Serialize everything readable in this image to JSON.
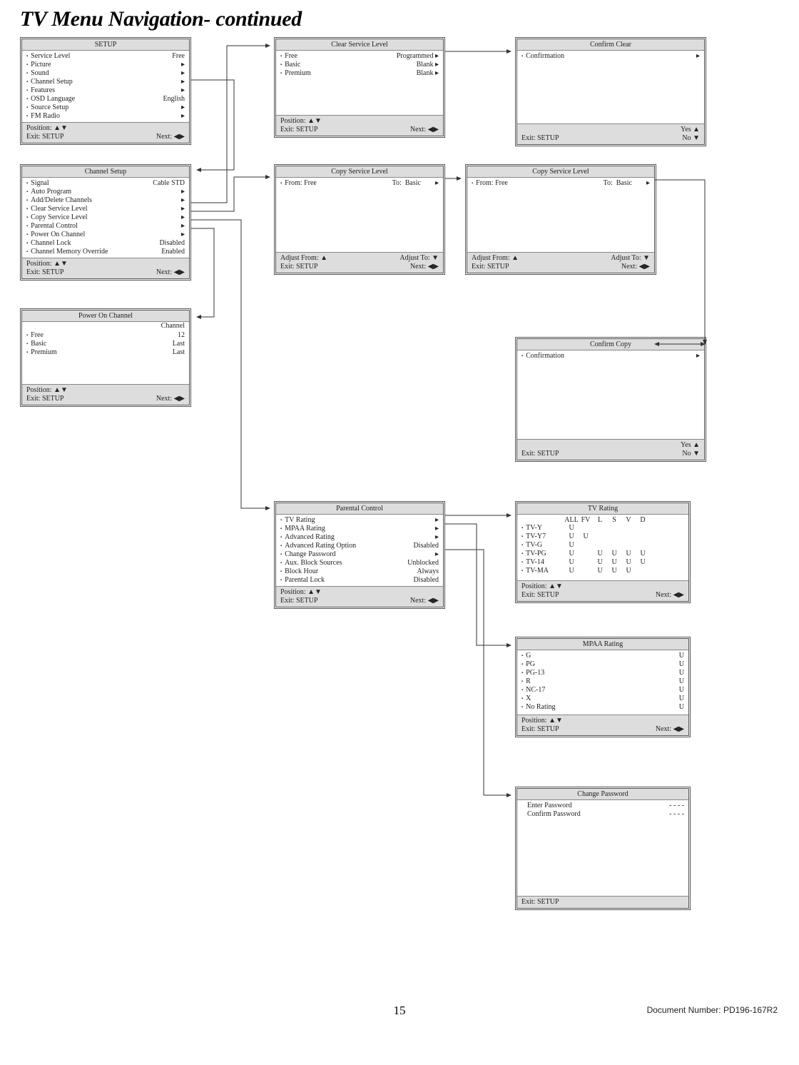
{
  "page_title": "TV Menu Navigation- continued",
  "page_number": "15",
  "doc_number": "Document Number: PD196-167R2",
  "sym": {
    "tri_r": "▸",
    "tri_u": "▲",
    "tri_d": "▼",
    "tri_l": "◀",
    "tri_r_solid": "▶"
  },
  "common_footer": {
    "position_label": "Position: ▲▼",
    "exit_label": "Exit: SETUP",
    "next_label": "Next: ◀▶"
  },
  "panels": {
    "setup": {
      "title": "SETUP",
      "rows": [
        {
          "l": "Service Level",
          "v": "Free"
        },
        {
          "l": "Picture",
          "v": "▸"
        },
        {
          "l": "Sound",
          "v": "▸"
        },
        {
          "l": "Channel Setup",
          "v": "▸"
        },
        {
          "l": "Features",
          "v": "▸"
        },
        {
          "l": "OSD Language",
          "v": "English"
        },
        {
          "l": "Source Setup",
          "v": "▸"
        },
        {
          "l": "FM Radio",
          "v": "▸"
        }
      ]
    },
    "channel_setup": {
      "title": "Channel Setup",
      "rows": [
        {
          "l": "Signal",
          "v": "Cable STD"
        },
        {
          "l": "Auto Program",
          "v": "▸"
        },
        {
          "l": "Add/Delete Channels",
          "v": "▸"
        },
        {
          "l": "Clear Service Level",
          "v": "▸"
        },
        {
          "l": "Copy Service Level",
          "v": "▸"
        },
        {
          "l": "Parental Control",
          "v": "▸"
        },
        {
          "l": "Power On Channel",
          "v": "▸"
        },
        {
          "l": "Channel Lock",
          "v": "Disabled"
        },
        {
          "l": "Channel Memory Override",
          "v": "Enabled"
        }
      ]
    },
    "power_on_channel": {
      "title": "Power On Channel",
      "pre_head": "Channel",
      "rows": [
        {
          "l": "Free",
          "v": "12"
        },
        {
          "l": "Basic",
          "v": "Last"
        },
        {
          "l": "Premium",
          "v": "Last"
        }
      ]
    },
    "clear_service_level": {
      "title": "Clear Service Level",
      "rows": [
        {
          "l": "Free",
          "v": "Programmed ▸"
        },
        {
          "l": "Basic",
          "v": "Blank ▸"
        },
        {
          "l": "Premium",
          "v": "Blank ▸"
        }
      ]
    },
    "confirm_clear": {
      "title": "Confirm Clear",
      "rows": [
        {
          "l": "Confirmation",
          "v": "▸"
        }
      ],
      "footer_right": {
        "yes": "Yes  ▲",
        "no": "No  ▼"
      }
    },
    "copy_service_level_1": {
      "title": "Copy Service Level",
      "rows": [
        {
          "l": "From:  Free",
          "v": "To:  Basic        ▸"
        }
      ],
      "footer_alt": {
        "l1l": "Adjust From: ▲",
        "l1r": "Adjust To: ▼",
        "l2l": "Exit: SETUP",
        "l2r": "Next: ◀▶"
      }
    },
    "copy_service_level_2": {
      "title": "Copy Service Level",
      "rows": [
        {
          "l": "From:  Free",
          "v": "To:  Basic        ▸"
        }
      ],
      "footer_alt": {
        "l1l": "Adjust From: ▲",
        "l1r": "Adjust To: ▼",
        "l2l": "Exit: SETUP",
        "l2r": "Next: ◀▶"
      }
    },
    "confirm_copy": {
      "title": "Confirm Copy",
      "rows": [
        {
          "l": "Confirmation",
          "v": "▸"
        }
      ],
      "footer_right": {
        "yes": "Yes  ▲",
        "no": "No  ▼"
      }
    },
    "parental_control": {
      "title": "Parental Control",
      "rows": [
        {
          "l": "TV Rating",
          "v": "▸"
        },
        {
          "l": "MPAA Rating",
          "v": "▸"
        },
        {
          "l": "Advanced Rating",
          "v": "▸"
        },
        {
          "l": "Advanced Rating Option",
          "v": "Disabled"
        },
        {
          "l": "Change Password",
          "v": "▸"
        },
        {
          "l": "Aux. Block Sources",
          "v": "Unblocked"
        },
        {
          "l": "Block Hour",
          "v": "Always"
        },
        {
          "l": "Parental Lock",
          "v": "Disabled"
        }
      ]
    },
    "tv_rating": {
      "title": "TV Rating",
      "grid_head": [
        "ALL",
        "FV",
        "L",
        "S",
        "V",
        "D"
      ],
      "grid_rows": [
        {
          "l": "TV-Y",
          "c": [
            "U",
            "",
            "",
            "",
            "",
            ""
          ]
        },
        {
          "l": "TV-Y7",
          "c": [
            "U",
            "U",
            "",
            "",
            "",
            ""
          ]
        },
        {
          "l": "TV-G",
          "c": [
            "U",
            "",
            "",
            "",
            "",
            ""
          ]
        },
        {
          "l": "TV-PG",
          "c": [
            "U",
            "",
            "U",
            "U",
            "U",
            "U"
          ]
        },
        {
          "l": "TV-14",
          "c": [
            "U",
            "",
            "U",
            "U",
            "U",
            "U"
          ]
        },
        {
          "l": "TV-MA",
          "c": [
            "U",
            "",
            "U",
            "U",
            "U",
            ""
          ]
        }
      ]
    },
    "mpaa_rating": {
      "title": "MPAA Rating",
      "rows": [
        {
          "l": "G",
          "v": "U"
        },
        {
          "l": "PG",
          "v": "U"
        },
        {
          "l": "PG-13",
          "v": "U"
        },
        {
          "l": "R",
          "v": "U"
        },
        {
          "l": "NC-17",
          "v": "U"
        },
        {
          "l": "X",
          "v": "U"
        },
        {
          "l": "No Rating",
          "v": "U"
        }
      ]
    },
    "change_password": {
      "title": "Change Password",
      "rows_nb": [
        {
          "l": "Enter Password",
          "v": "- - - -"
        },
        {
          "l": "Confirm Password",
          "v": "- - - -"
        }
      ],
      "footer_exit_only": "Exit: SETUP"
    }
  }
}
